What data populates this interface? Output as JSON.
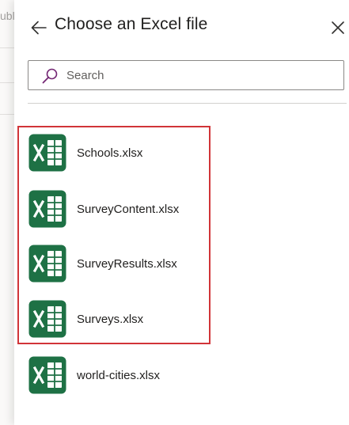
{
  "background": {
    "partial_text": "ublis"
  },
  "panel": {
    "title": "Choose an Excel file",
    "back_icon": "arrow-left-icon",
    "close_icon": "close-icon"
  },
  "search": {
    "placeholder": "Search",
    "value": "",
    "icon": "search-icon"
  },
  "files": [
    {
      "name": "Schools.xlsx",
      "icon": "excel-file-icon",
      "highlighted": true
    },
    {
      "name": "SurveyContent.xlsx",
      "icon": "excel-file-icon",
      "highlighted": true
    },
    {
      "name": "SurveyResults.xlsx",
      "icon": "excel-file-icon",
      "highlighted": true
    },
    {
      "name": "Surveys.xlsx",
      "icon": "excel-file-icon",
      "highlighted": true
    },
    {
      "name": "world-cities.xlsx",
      "icon": "excel-file-icon",
      "highlighted": false
    }
  ],
  "colors": {
    "excel_green": "#1e7145",
    "highlight_border": "#d13438",
    "search_accent": "#742774"
  }
}
